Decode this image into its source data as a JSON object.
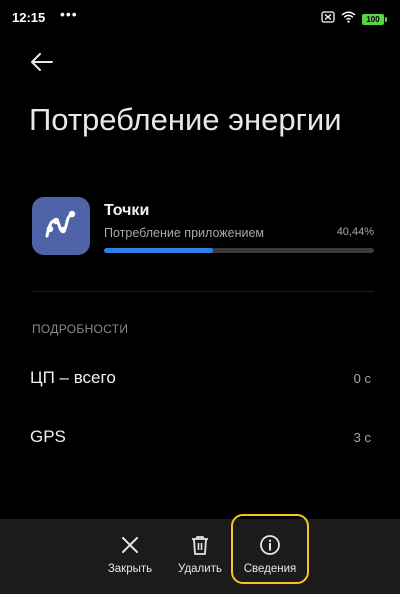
{
  "status_bar": {
    "time": "12:15",
    "dots": "•••",
    "battery": "100",
    "icons": [
      "notifications-off-icon",
      "wifi-icon",
      "battery-icon"
    ]
  },
  "header": {
    "back_icon": "arrow-left-icon",
    "title": "Потребление энергии"
  },
  "app": {
    "name": "Точки",
    "icon": "route-points-icon",
    "icon_bg_color": "#4f63a8",
    "usage_label": "Потребление приложением",
    "usage_value": "40,44%",
    "usage_fraction": 0.4044,
    "bar_color": "#2f7fe8"
  },
  "details": {
    "section_title": "ПОДРОБНОСТИ",
    "rows": [
      {
        "label": "ЦП – всего",
        "value": "0 с"
      },
      {
        "label": "GPS",
        "value": "3 с"
      }
    ]
  },
  "bottom_bar": {
    "actions": [
      {
        "label": "Закрыть",
        "icon": "close-icon"
      },
      {
        "label": "Удалить",
        "icon": "trash-icon"
      },
      {
        "label": "Сведения",
        "icon": "info-icon",
        "highlighted": true
      }
    ],
    "highlight_color": "#f4c622"
  }
}
